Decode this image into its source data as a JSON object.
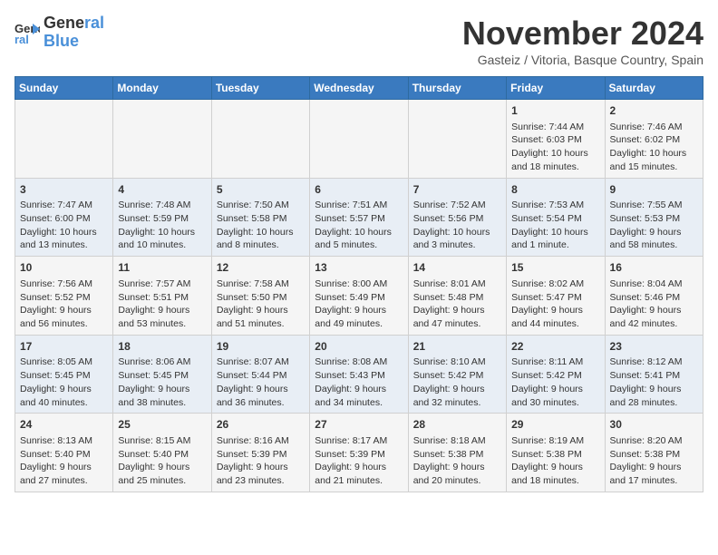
{
  "logo": {
    "line1": "General",
    "line2": "Blue"
  },
  "title": "November 2024",
  "subtitle": "Gasteiz / Vitoria, Basque Country, Spain",
  "headers": [
    "Sunday",
    "Monday",
    "Tuesday",
    "Wednesday",
    "Thursday",
    "Friday",
    "Saturday"
  ],
  "weeks": [
    [
      {
        "day": "",
        "content": ""
      },
      {
        "day": "",
        "content": ""
      },
      {
        "day": "",
        "content": ""
      },
      {
        "day": "",
        "content": ""
      },
      {
        "day": "",
        "content": ""
      },
      {
        "day": "1",
        "content": "Sunrise: 7:44 AM\nSunset: 6:03 PM\nDaylight: 10 hours\nand 18 minutes."
      },
      {
        "day": "2",
        "content": "Sunrise: 7:46 AM\nSunset: 6:02 PM\nDaylight: 10 hours\nand 15 minutes."
      }
    ],
    [
      {
        "day": "3",
        "content": "Sunrise: 7:47 AM\nSunset: 6:00 PM\nDaylight: 10 hours\nand 13 minutes."
      },
      {
        "day": "4",
        "content": "Sunrise: 7:48 AM\nSunset: 5:59 PM\nDaylight: 10 hours\nand 10 minutes."
      },
      {
        "day": "5",
        "content": "Sunrise: 7:50 AM\nSunset: 5:58 PM\nDaylight: 10 hours\nand 8 minutes."
      },
      {
        "day": "6",
        "content": "Sunrise: 7:51 AM\nSunset: 5:57 PM\nDaylight: 10 hours\nand 5 minutes."
      },
      {
        "day": "7",
        "content": "Sunrise: 7:52 AM\nSunset: 5:56 PM\nDaylight: 10 hours\nand 3 minutes."
      },
      {
        "day": "8",
        "content": "Sunrise: 7:53 AM\nSunset: 5:54 PM\nDaylight: 10 hours\nand 1 minute."
      },
      {
        "day": "9",
        "content": "Sunrise: 7:55 AM\nSunset: 5:53 PM\nDaylight: 9 hours\nand 58 minutes."
      }
    ],
    [
      {
        "day": "10",
        "content": "Sunrise: 7:56 AM\nSunset: 5:52 PM\nDaylight: 9 hours\nand 56 minutes."
      },
      {
        "day": "11",
        "content": "Sunrise: 7:57 AM\nSunset: 5:51 PM\nDaylight: 9 hours\nand 53 minutes."
      },
      {
        "day": "12",
        "content": "Sunrise: 7:58 AM\nSunset: 5:50 PM\nDaylight: 9 hours\nand 51 minutes."
      },
      {
        "day": "13",
        "content": "Sunrise: 8:00 AM\nSunset: 5:49 PM\nDaylight: 9 hours\nand 49 minutes."
      },
      {
        "day": "14",
        "content": "Sunrise: 8:01 AM\nSunset: 5:48 PM\nDaylight: 9 hours\nand 47 minutes."
      },
      {
        "day": "15",
        "content": "Sunrise: 8:02 AM\nSunset: 5:47 PM\nDaylight: 9 hours\nand 44 minutes."
      },
      {
        "day": "16",
        "content": "Sunrise: 8:04 AM\nSunset: 5:46 PM\nDaylight: 9 hours\nand 42 minutes."
      }
    ],
    [
      {
        "day": "17",
        "content": "Sunrise: 8:05 AM\nSunset: 5:45 PM\nDaylight: 9 hours\nand 40 minutes."
      },
      {
        "day": "18",
        "content": "Sunrise: 8:06 AM\nSunset: 5:45 PM\nDaylight: 9 hours\nand 38 minutes."
      },
      {
        "day": "19",
        "content": "Sunrise: 8:07 AM\nSunset: 5:44 PM\nDaylight: 9 hours\nand 36 minutes."
      },
      {
        "day": "20",
        "content": "Sunrise: 8:08 AM\nSunset: 5:43 PM\nDaylight: 9 hours\nand 34 minutes."
      },
      {
        "day": "21",
        "content": "Sunrise: 8:10 AM\nSunset: 5:42 PM\nDaylight: 9 hours\nand 32 minutes."
      },
      {
        "day": "22",
        "content": "Sunrise: 8:11 AM\nSunset: 5:42 PM\nDaylight: 9 hours\nand 30 minutes."
      },
      {
        "day": "23",
        "content": "Sunrise: 8:12 AM\nSunset: 5:41 PM\nDaylight: 9 hours\nand 28 minutes."
      }
    ],
    [
      {
        "day": "24",
        "content": "Sunrise: 8:13 AM\nSunset: 5:40 PM\nDaylight: 9 hours\nand 27 minutes."
      },
      {
        "day": "25",
        "content": "Sunrise: 8:15 AM\nSunset: 5:40 PM\nDaylight: 9 hours\nand 25 minutes."
      },
      {
        "day": "26",
        "content": "Sunrise: 8:16 AM\nSunset: 5:39 PM\nDaylight: 9 hours\nand 23 minutes."
      },
      {
        "day": "27",
        "content": "Sunrise: 8:17 AM\nSunset: 5:39 PM\nDaylight: 9 hours\nand 21 minutes."
      },
      {
        "day": "28",
        "content": "Sunrise: 8:18 AM\nSunset: 5:38 PM\nDaylight: 9 hours\nand 20 minutes."
      },
      {
        "day": "29",
        "content": "Sunrise: 8:19 AM\nSunset: 5:38 PM\nDaylight: 9 hours\nand 18 minutes."
      },
      {
        "day": "30",
        "content": "Sunrise: 8:20 AM\nSunset: 5:38 PM\nDaylight: 9 hours\nand 17 minutes."
      }
    ]
  ]
}
